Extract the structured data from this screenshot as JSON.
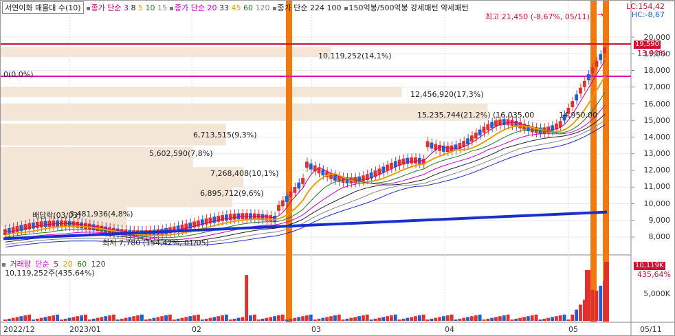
{
  "legend": {
    "title": "서연이화 매물대 수(10)",
    "ma_price_a": {
      "label": "종가 단순",
      "periods": [
        "3",
        "8",
        "5",
        "10",
        "15"
      ],
      "colors": [
        "#cc0077",
        "#222222",
        "#e6a000",
        "#1e7e1e",
        "#888888"
      ]
    },
    "ma_price_b": {
      "label": "종가 단순",
      "periods": [
        "20",
        "33",
        "45",
        "60",
        "120"
      ],
      "colors": [
        "#cc00cc",
        "#222222",
        "#e6a000",
        "#1e7e1e",
        "#888888"
      ]
    },
    "ma_price_c": {
      "label": "종가 단순",
      "periods": [
        "224",
        "100"
      ]
    },
    "pattern": "150억봉/500억봉 강세패턴  약세패턴"
  },
  "overlays": {
    "high": "최고 21,450 (-8,67%, 05/11)",
    "low": "최저 7,780 (154,42%, 01/05)",
    "dividend": "배당락(03/03)",
    "zero_line": "0(0,0%)",
    "volume_profile": [
      "10,119,252(14,1%)",
      "12,456,920(17,3%)",
      "15,235,744(21,2%)",
      "6,713,515(9,3%)",
      "5,602,590(7,8%)",
      "7,268,408(10,1%)",
      "6,895,712(9,6%)",
      "3,481,936(4,8%)"
    ],
    "price_labels": [
      "(16,035,00",
      "14,950,00"
    ]
  },
  "right_panel": {
    "lc": "LC:154,42",
    "hc": "HC:-8,67",
    "price_axis": [
      "20,000",
      "19,000",
      "18,000",
      "17,000",
      "16,000",
      "15,000",
      "14,000",
      "13,000",
      "12,000",
      "11,000",
      "10,000",
      "9,000",
      "8,000"
    ],
    "current_price": "19,590",
    "current_pct": "13,90%",
    "volume_tag": "10,119K",
    "volume_pct": "435,64%",
    "volume_axis": "5,000K"
  },
  "volume_legend": {
    "title": "거래량",
    "label": "단순",
    "periods": [
      "5",
      "20",
      "60",
      "120"
    ],
    "colors": [
      "#cc00cc",
      "#e6a000",
      "#1e7e1e",
      "#444444"
    ],
    "value": "10,119,252주(435,64%)"
  },
  "x_axis": [
    "2022/12",
    "2023/01",
    "02",
    "03",
    "04",
    "05",
    "05/11"
  ],
  "colors": {
    "up": "#e03030",
    "down": "#1f5fd0",
    "profile": "#f3e6d6",
    "vline": "#f07a10",
    "redline": "#d01030",
    "pinkline": "#e010b0",
    "ma224": "#1a2fd0"
  },
  "chart_data": {
    "type": "candlestick",
    "y_axis_range": [
      7500,
      21500
    ],
    "series_markers": {
      "high": {
        "value": 21450,
        "date": "05/11"
      },
      "low": {
        "value": 7780,
        "date": "01/05"
      },
      "current": 19590
    },
    "volume_profile_levels": [
      {
        "price_from": 18800,
        "price_to": 19400,
        "volume": 10119252,
        "pct": 14.1
      },
      {
        "price_from": 16400,
        "price_to": 17000,
        "volume": 12456920,
        "pct": 17.3
      },
      {
        "price_from": 15000,
        "price_to": 16000,
        "volume": 15235744,
        "pct": 21.2
      },
      {
        "price_from": 13500,
        "price_to": 14800,
        "volume": 6713515,
        "pct": 9.3
      },
      {
        "price_from": 12200,
        "price_to": 13400,
        "volume": 5602590,
        "pct": 7.8
      },
      {
        "price_from": 11000,
        "price_to": 12200,
        "volume": 7268408,
        "pct": 10.1
      },
      {
        "price_from": 9800,
        "price_to": 11000,
        "volume": 6895712,
        "pct": 9.6
      },
      {
        "price_from": 8600,
        "price_to": 9800,
        "volume": 3481936,
        "pct": 4.8
      }
    ]
  }
}
